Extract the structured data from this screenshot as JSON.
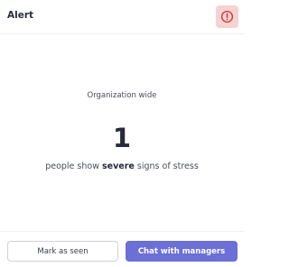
{
  "header": {
    "title": "Alert",
    "alert_icon": "exclamation-circle-icon"
  },
  "main": {
    "scope": "Organization wide",
    "count": "1",
    "description_prefix": "people show ",
    "description_emphasis": "severe",
    "description_suffix": " signs of stress"
  },
  "footer": {
    "mark_seen_label": "Mark as seen",
    "chat_label": "Chat with managers"
  },
  "colors": {
    "accent": "#6b6fd6",
    "alert_bg": "#f6d3d3",
    "alert_fg": "#d23b3b"
  }
}
